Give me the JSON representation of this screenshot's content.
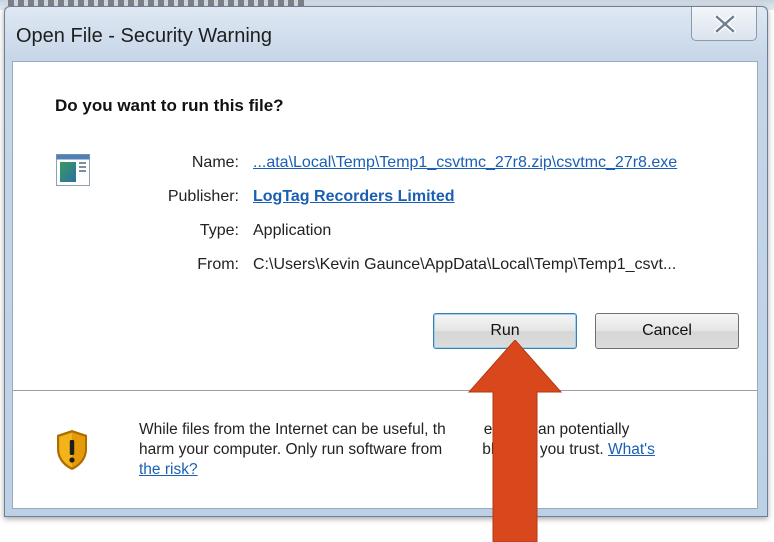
{
  "window": {
    "title": "Open File - Security Warning"
  },
  "dialog": {
    "question": "Do you want to run this file?",
    "fields": {
      "name_label": "Name:",
      "name_value": "...ata\\Local\\Temp\\Temp1_csvtmc_27r8.zip\\csvtmc_27r8.exe",
      "publisher_label": "Publisher:",
      "publisher_value": "LogTag Recorders Limited",
      "type_label": "Type:",
      "type_value": "Application",
      "from_label": "From:",
      "from_value": "C:\\Users\\Kevin Gaunce\\AppData\\Local\\Temp\\Temp1_csvt..."
    },
    "buttons": {
      "run": "Run",
      "cancel": "Cancel"
    },
    "footer": {
      "warning_line1": "While files from the Internet can be useful, th",
      "warning_line1b": "e type can potentially",
      "warning_line2": "harm your computer. Only run software from",
      "warning_line2b": "blishers you trust.",
      "risk_link_part1": "What's",
      "risk_link_part2": "the risk?"
    }
  },
  "icons": {
    "close": "close-icon",
    "file": "application-file-icon",
    "shield": "security-shield-icon",
    "arrow": "red-arrow-annotation"
  },
  "colors": {
    "link": "#1a5fb4",
    "arrow": "#d9481c",
    "shield": "#e7a20c"
  }
}
